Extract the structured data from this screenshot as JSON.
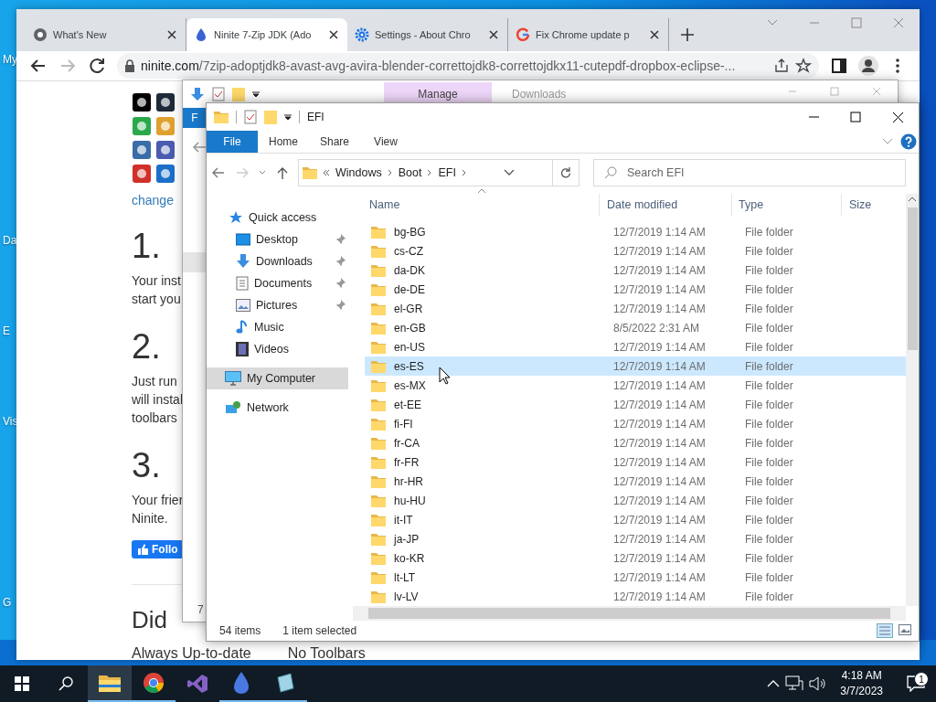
{
  "desktop": {
    "icon_labels": [
      "My",
      "Da",
      "E",
      "Vis",
      "G"
    ]
  },
  "browser": {
    "tabs": [
      {
        "title": "What's New",
        "kind": "chrome",
        "selected": false
      },
      {
        "title": "Ninite 7-Zip JDK (Ado",
        "kind": "ninite",
        "selected": true
      },
      {
        "title": "Settings - About Chro",
        "kind": "settings",
        "selected": false
      },
      {
        "title": "Fix Chrome update p",
        "kind": "google",
        "selected": false
      }
    ],
    "url_host": "ninite.com",
    "url_path": "/7zip-adoptjdk8-avast-avg-avira-blender-correttojdk8-correttojdkx11-cutepdf-dropbox-eclipse-...",
    "page": {
      "link": "change",
      "steps": [
        {
          "heading": "1.",
          "lines": [
            "Your inst",
            "start you"
          ]
        },
        {
          "heading": "2.",
          "lines": [
            "Just run",
            "will instal",
            "toolbars"
          ]
        },
        {
          "heading": "3.",
          "lines": [
            "Your frier",
            "Ninite."
          ]
        }
      ],
      "follow_button": "Follo",
      "section_heading": "Did",
      "features": [
        "Always Up-to-date",
        "No Toolbars"
      ]
    }
  },
  "back_explorer": {
    "ribbon_context": "Manage",
    "title": "Downloads",
    "file_tab": "F",
    "status": "7"
  },
  "explorer": {
    "title": "EFI",
    "ribbon_tabs": [
      {
        "label": "File",
        "selected": true
      },
      {
        "label": "Home",
        "selected": false
      },
      {
        "label": "Share",
        "selected": false
      },
      {
        "label": "View",
        "selected": false
      }
    ],
    "breadcrumb": [
      "Windows",
      "Boot",
      "EFI"
    ],
    "search": {
      "placeholder": "Search EFI"
    },
    "nav": [
      {
        "label": "Quick access",
        "kind": "star",
        "selected": false,
        "children": [
          {
            "label": "Desktop",
            "kind": "desktop",
            "pinned": true,
            "selected": false
          },
          {
            "label": "Downloads",
            "kind": "download",
            "pinned": true,
            "selected": false
          },
          {
            "label": "Documents",
            "kind": "document",
            "pinned": true,
            "selected": false
          },
          {
            "label": "Pictures",
            "kind": "picture",
            "pinned": true,
            "selected": false
          },
          {
            "label": "Music",
            "kind": "music",
            "pinned": false,
            "selected": false
          },
          {
            "label": "Videos",
            "kind": "video",
            "pinned": false,
            "selected": false
          }
        ]
      },
      {
        "label": "My Computer",
        "kind": "computer",
        "selected": true
      },
      {
        "label": "Network",
        "kind": "network",
        "selected": false
      }
    ],
    "columns": [
      "Name",
      "Date modified",
      "Type",
      "Size"
    ],
    "rows": [
      {
        "name": "bg-BG",
        "date": "12/7/2019 1:14 AM",
        "type": "File folder",
        "selected": false
      },
      {
        "name": "cs-CZ",
        "date": "12/7/2019 1:14 AM",
        "type": "File folder",
        "selected": false
      },
      {
        "name": "da-DK",
        "date": "12/7/2019 1:14 AM",
        "type": "File folder",
        "selected": false
      },
      {
        "name": "de-DE",
        "date": "12/7/2019 1:14 AM",
        "type": "File folder",
        "selected": false
      },
      {
        "name": "el-GR",
        "date": "12/7/2019 1:14 AM",
        "type": "File folder",
        "selected": false
      },
      {
        "name": "en-GB",
        "date": "8/5/2022 2:31 AM",
        "type": "File folder",
        "selected": false
      },
      {
        "name": "en-US",
        "date": "12/7/2019 1:14 AM",
        "type": "File folder",
        "selected": false
      },
      {
        "name": "es-ES",
        "date": "12/7/2019 1:14 AM",
        "type": "File folder",
        "selected": true
      },
      {
        "name": "es-MX",
        "date": "12/7/2019 1:14 AM",
        "type": "File folder",
        "selected": false
      },
      {
        "name": "et-EE",
        "date": "12/7/2019 1:14 AM",
        "type": "File folder",
        "selected": false
      },
      {
        "name": "fi-FI",
        "date": "12/7/2019 1:14 AM",
        "type": "File folder",
        "selected": false
      },
      {
        "name": "fr-CA",
        "date": "12/7/2019 1:14 AM",
        "type": "File folder",
        "selected": false
      },
      {
        "name": "fr-FR",
        "date": "12/7/2019 1:14 AM",
        "type": "File folder",
        "selected": false
      },
      {
        "name": "hr-HR",
        "date": "12/7/2019 1:14 AM",
        "type": "File folder",
        "selected": false
      },
      {
        "name": "hu-HU",
        "date": "12/7/2019 1:14 AM",
        "type": "File folder",
        "selected": false
      },
      {
        "name": "it-IT",
        "date": "12/7/2019 1:14 AM",
        "type": "File folder",
        "selected": false
      },
      {
        "name": "ja-JP",
        "date": "12/7/2019 1:14 AM",
        "type": "File folder",
        "selected": false
      },
      {
        "name": "ko-KR",
        "date": "12/7/2019 1:14 AM",
        "type": "File folder",
        "selected": false
      },
      {
        "name": "lt-LT",
        "date": "12/7/2019 1:14 AM",
        "type": "File folder",
        "selected": false
      },
      {
        "name": "lv-LV",
        "date": "12/7/2019 1:14 AM",
        "type": "File folder",
        "selected": false
      }
    ],
    "status": {
      "count": "54 items",
      "selection": "1 item selected"
    }
  },
  "taskbar": {
    "apps": [
      {
        "kind": "explorer",
        "running": true,
        "active": true
      },
      {
        "kind": "chrome",
        "running": true,
        "active": false
      },
      {
        "kind": "studio",
        "running": false,
        "active": false
      },
      {
        "kind": "ninite",
        "running": true,
        "active": false
      },
      {
        "kind": "notes",
        "running": true,
        "active": false
      }
    ],
    "time": "4:18 AM",
    "date": "3/7/2023",
    "notification_count": "1"
  }
}
